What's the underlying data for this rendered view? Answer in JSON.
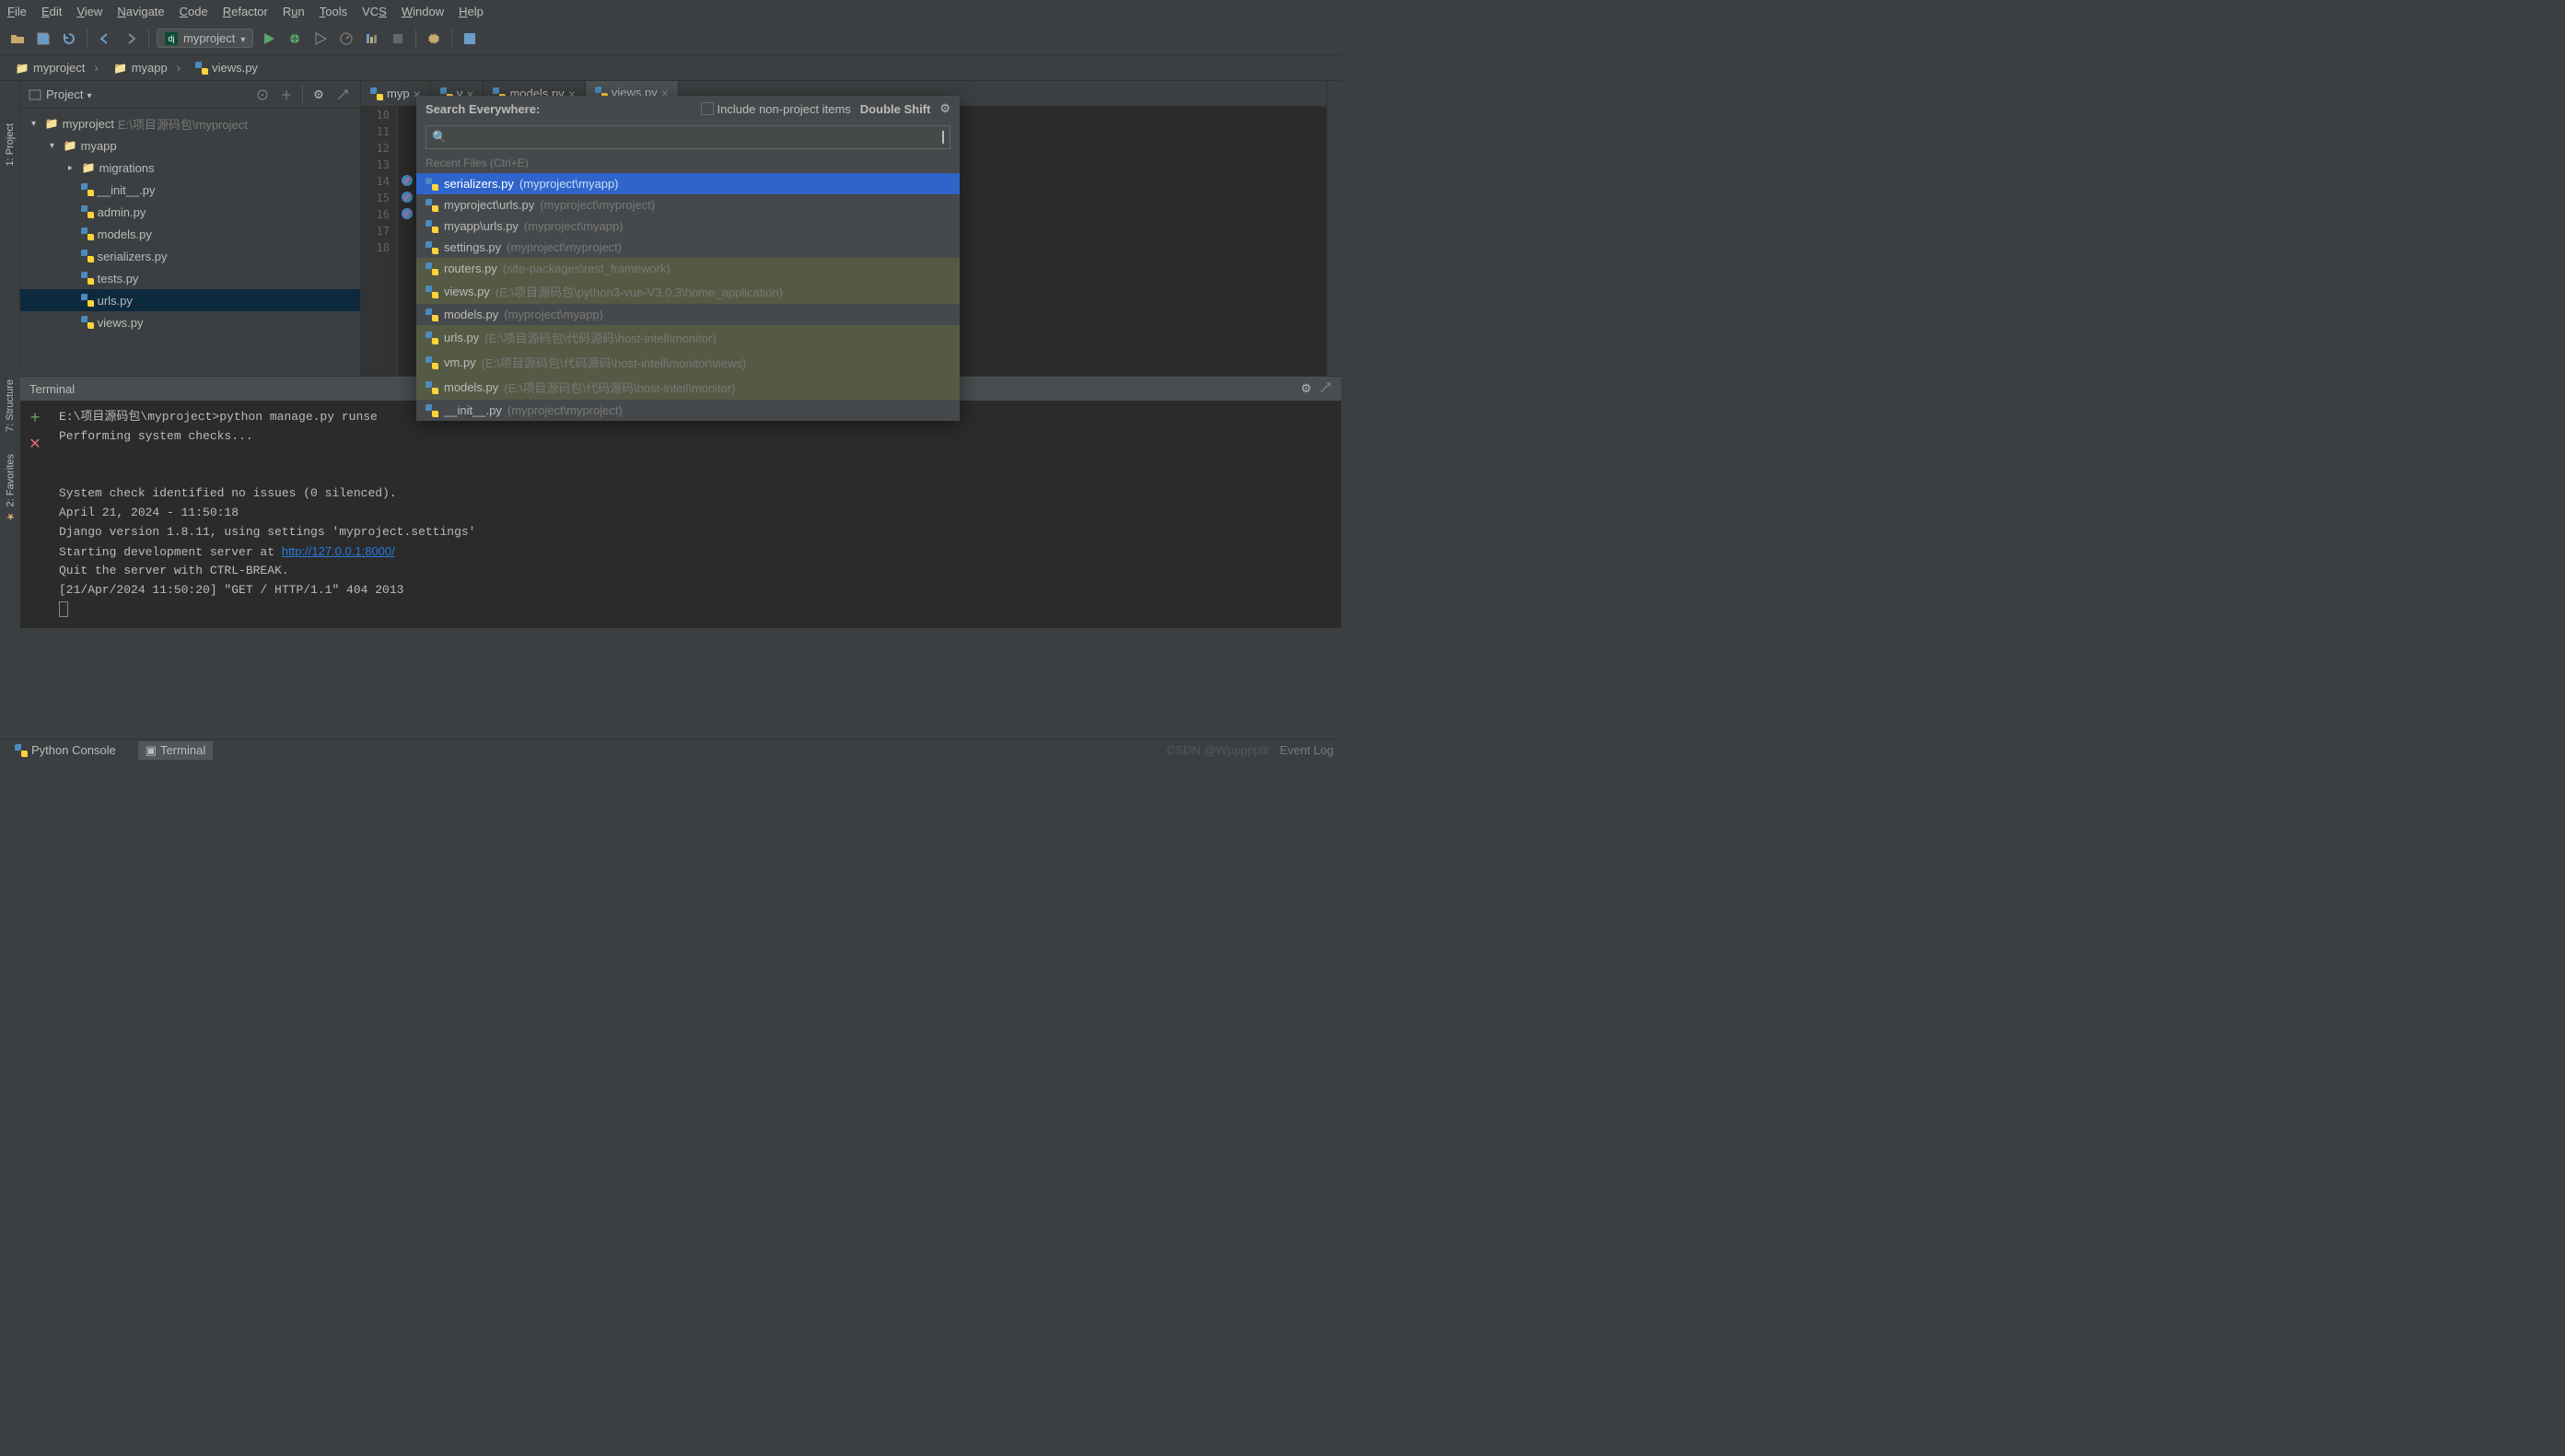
{
  "menubar": [
    "File",
    "Edit",
    "View",
    "Navigate",
    "Code",
    "Refactor",
    "Run",
    "Tools",
    "VCS",
    "Window",
    "Help"
  ],
  "toolbar": {
    "run_config": "myproject"
  },
  "breadcrumb": [
    {
      "icon": "folder",
      "label": "myproject"
    },
    {
      "icon": "folder",
      "label": "myapp"
    },
    {
      "icon": "py",
      "label": "views.py"
    }
  ],
  "project_panel": {
    "title": "Project",
    "tree": [
      {
        "depth": 0,
        "arrow": "▾",
        "icon": "folder",
        "label": "myproject",
        "path": "E:\\项目源码包\\myproject"
      },
      {
        "depth": 1,
        "arrow": "▾",
        "icon": "folder",
        "label": "myapp"
      },
      {
        "depth": 2,
        "arrow": "▸",
        "icon": "folder",
        "label": "migrations"
      },
      {
        "depth": 2,
        "icon": "py",
        "label": "__init__.py"
      },
      {
        "depth": 2,
        "icon": "py",
        "label": "admin.py"
      },
      {
        "depth": 2,
        "icon": "py",
        "label": "models.py"
      },
      {
        "depth": 2,
        "icon": "py",
        "label": "serializers.py"
      },
      {
        "depth": 2,
        "icon": "py",
        "label": "tests.py"
      },
      {
        "depth": 2,
        "icon": "py",
        "label": "urls.py",
        "selected": true
      },
      {
        "depth": 2,
        "icon": "py",
        "label": "views.py"
      }
    ]
  },
  "editor_tabs": [
    {
      "label": "myp",
      "icon": "py"
    },
    {
      "label": "y",
      "icon": "py",
      "partial": true
    },
    {
      "label": "models.py",
      "icon": "py"
    },
    {
      "label": "views.py",
      "icon": "py",
      "active": true
    }
  ],
  "gutter_lines": [
    10,
    11,
    12,
    13,
    14,
    15,
    16,
    17,
    18
  ],
  "search": {
    "title": "Search Everywhere:",
    "checkbox_label": "Include non-project items",
    "shortcut": "Double Shift",
    "section": "Recent Files (Ctrl+E)",
    "results": [
      {
        "name": "serializers.py",
        "path": "(myproject\\myapp)",
        "selected": true
      },
      {
        "name": "myproject\\urls.py",
        "path": "(myproject\\myproject)"
      },
      {
        "name": "myapp\\urls.py",
        "path": "(myproject\\myapp)"
      },
      {
        "name": "settings.py",
        "path": "(myproject\\myproject)"
      },
      {
        "name": "routers.py",
        "path": "(site-packages\\rest_framework)",
        "alt": true
      },
      {
        "name": "views.py",
        "path": "(E:\\项目源码包\\python3-vue-V3.0.3\\home_application)",
        "alt": true
      },
      {
        "name": "models.py",
        "path": "(myproject\\myapp)"
      },
      {
        "name": "urls.py",
        "path": "(E:\\项目源码包\\代码源码\\host-intell\\monitor)",
        "alt": true
      },
      {
        "name": "vm.py",
        "path": "(E:\\项目源码包\\代码源码\\host-intell\\monitor\\views)",
        "alt": true
      },
      {
        "name": "models.py",
        "path": "(E:\\项目源码包\\代码源码\\host-intell\\monitor)",
        "alt": true
      },
      {
        "name": "__init__.py",
        "path": "(myproject\\myproject)"
      }
    ]
  },
  "terminal": {
    "title": "Terminal",
    "lines": [
      "E:\\项目源码包\\myproject>python manage.py runse",
      "Performing system checks...",
      "",
      "",
      "System check identified no issues (0 silenced).",
      "April 21, 2024 - 11:50:18",
      "Django version 1.8.11, using settings 'myproject.settings'",
      "Starting development server at ",
      "Quit the server with CTRL-BREAK.",
      "[21/Apr/2024 11:50:20] \"GET / HTTP/1.1\" 404 2013"
    ],
    "link": "http://127.0.0.1:8000/"
  },
  "bottom": {
    "python_console": "Python Console",
    "terminal": "Terminal",
    "event_log": "Event Log",
    "watermark": "CSDN @Wppppplll"
  },
  "left_tabs": {
    "project": "1: Project",
    "structure": "7: Structure",
    "favorites": "2: Favorites"
  }
}
